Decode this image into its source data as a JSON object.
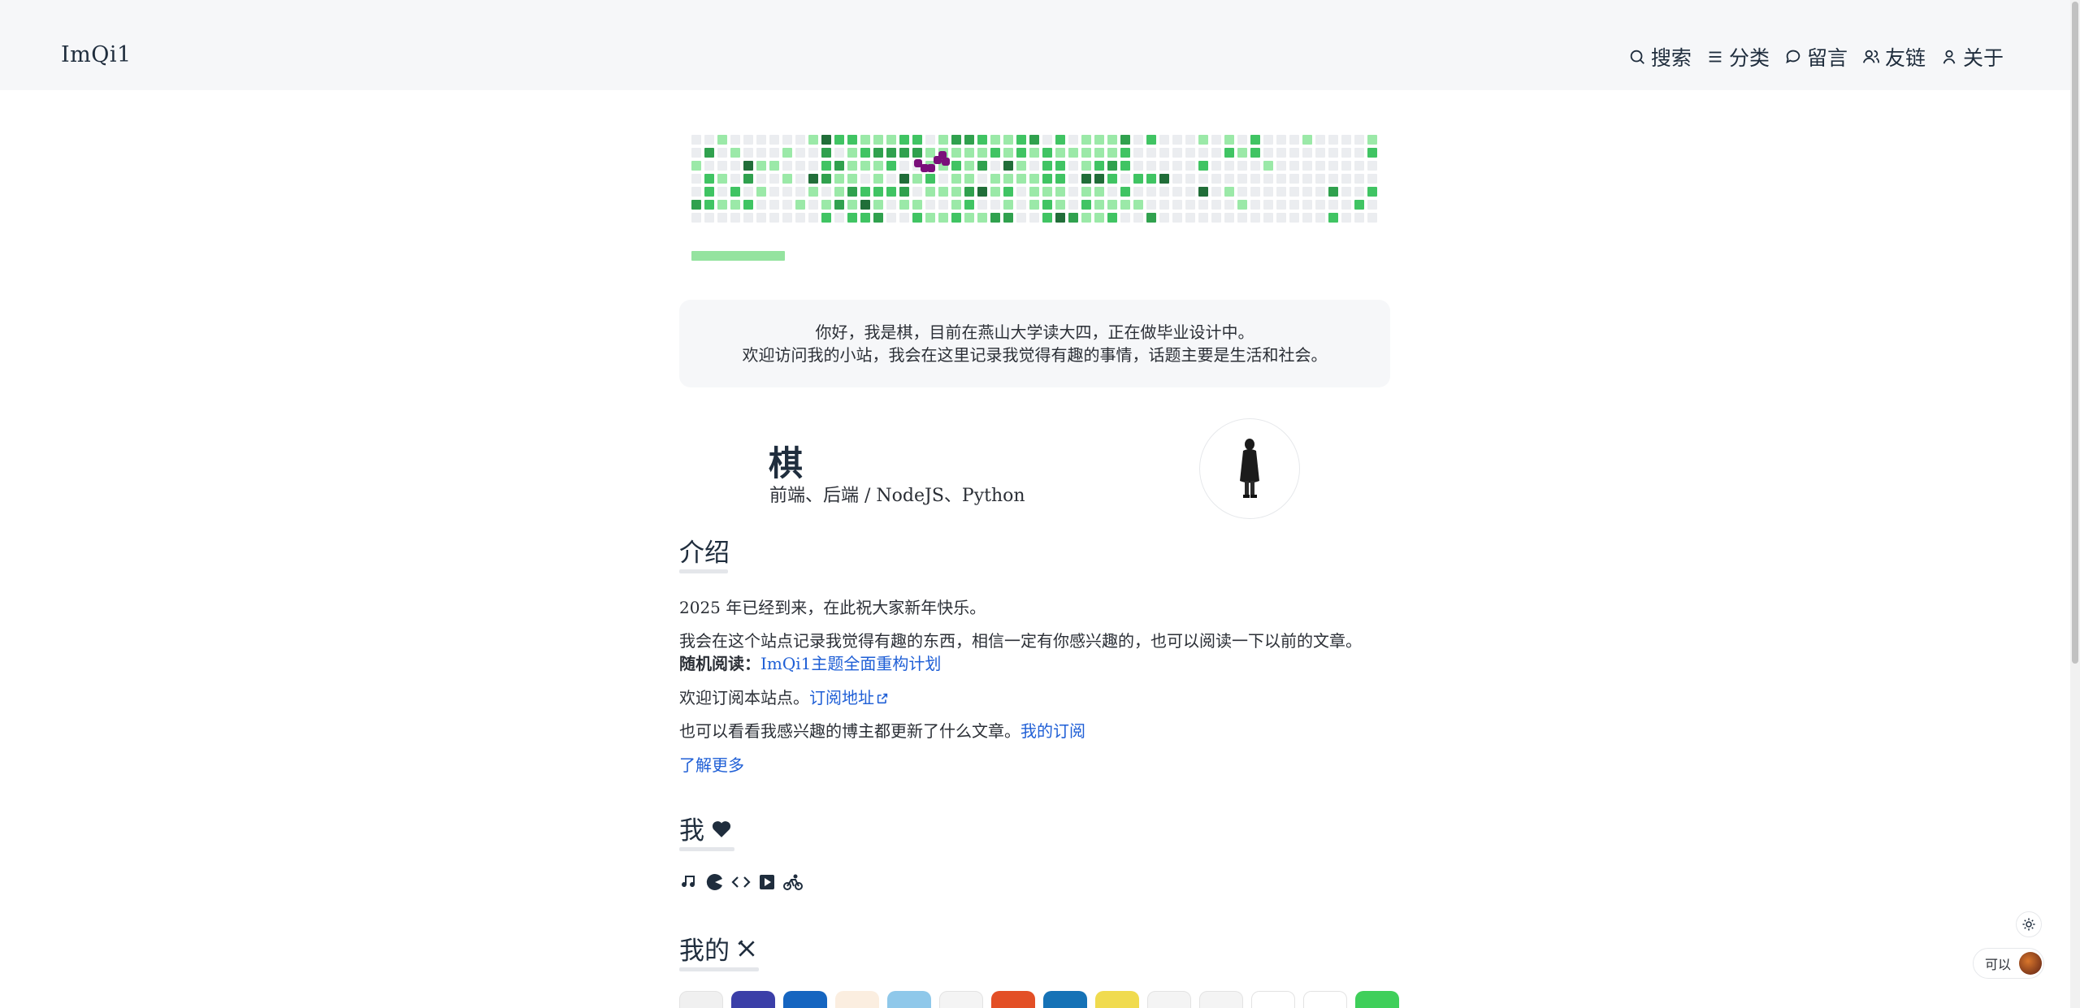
{
  "header": {
    "brand": "ImQi1",
    "nav": [
      {
        "label": "搜索",
        "icon": "search-icon"
      },
      {
        "label": "分类",
        "icon": "list-icon"
      },
      {
        "label": "留言",
        "icon": "chat-bubble-icon"
      },
      {
        "label": "友链",
        "icon": "friends-icon"
      },
      {
        "label": "关于",
        "icon": "user-icon"
      }
    ]
  },
  "colors": {
    "heat_levels": [
      "#ebedf0",
      "#9be9a8",
      "#40c463",
      "#30a14e",
      "#216e39"
    ],
    "accent_purple": "#7a0f7a",
    "link": "#1f5fd6"
  },
  "intro_card": {
    "line1": "你好，我是棋，目前在燕山大学读大四，正在做毕业设计中。",
    "line2": "欢迎访问我的小站，我会在这里记录我觉得有趣的事情，话题主要是生活和社会。"
  },
  "profile": {
    "name": "棋",
    "tags": "前端、后端 / NodeJS、Python"
  },
  "about": {
    "title": "介绍",
    "p1": "2025 年已经到来，在此祝大家新年快乐。",
    "p2": "我会在这个站点记录我觉得有趣的东西，相信一定有你感兴趣的，也可以阅读一下以前的文章。",
    "random_label": "随机阅读：",
    "random_link": "ImQi1主题全面重构计划",
    "p3": "欢迎订阅本站点。",
    "subscribe_link": "订阅地址",
    "p4": "也可以看看我感兴趣的博主都更新了什么文章。",
    "my_subs_link": "我的订阅",
    "more_link": "了解更多"
  },
  "me": {
    "title": "我",
    "hobbies": [
      "music-icon",
      "pacman-icon",
      "code-icon",
      "play-icon",
      "bicycle-icon"
    ]
  },
  "tools": {
    "title": "我的",
    "items": [
      "regex-icon",
      "app-icon",
      "app-icon",
      "scala-icon",
      "sqlite-icon",
      "mysql-icon",
      "html5-icon",
      "css3-icon",
      "js-icon",
      "plus-icon",
      "terminal-icon",
      "fish-icon",
      "python-icon",
      "green-app-icon"
    ]
  },
  "floating": {
    "user_label": "可以"
  }
}
